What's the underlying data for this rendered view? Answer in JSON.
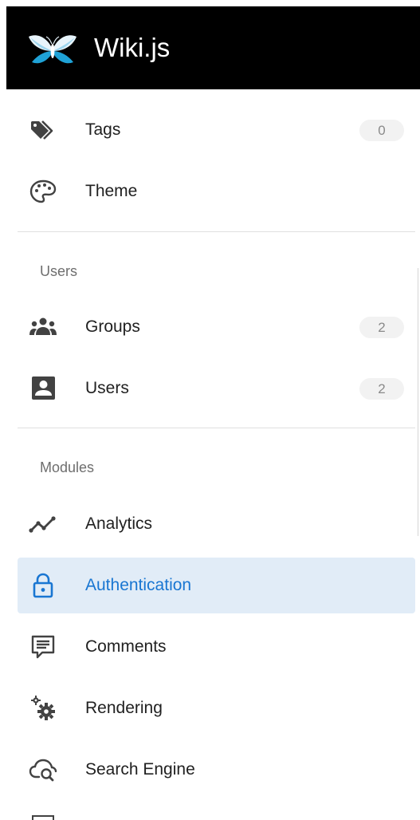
{
  "header": {
    "app_name": "Wiki.js",
    "logo_icon": "wikijs-logo-icon"
  },
  "nav_top": [
    {
      "label": "Tags",
      "icon": "tags-icon",
      "count": "0"
    },
    {
      "label": "Theme",
      "icon": "palette-icon"
    }
  ],
  "sections": {
    "users": "Users",
    "modules": "Modules"
  },
  "nav_users": [
    {
      "label": "Groups",
      "icon": "groups-icon",
      "count": "2"
    },
    {
      "label": "Users",
      "icon": "user-card-icon",
      "count": "2"
    }
  ],
  "nav_modules": [
    {
      "label": "Analytics",
      "icon": "analytics-icon"
    },
    {
      "label": "Authentication",
      "icon": "lock-icon",
      "active": true
    },
    {
      "label": "Comments",
      "icon": "comment-icon"
    },
    {
      "label": "Rendering",
      "icon": "gears-icon"
    },
    {
      "label": "Search Engine",
      "icon": "cloud-search-icon"
    }
  ],
  "colors": {
    "header_bg": "#000000",
    "active_bg": "#e1ecf7",
    "active_text": "#1976d2",
    "icon": "#424242"
  }
}
